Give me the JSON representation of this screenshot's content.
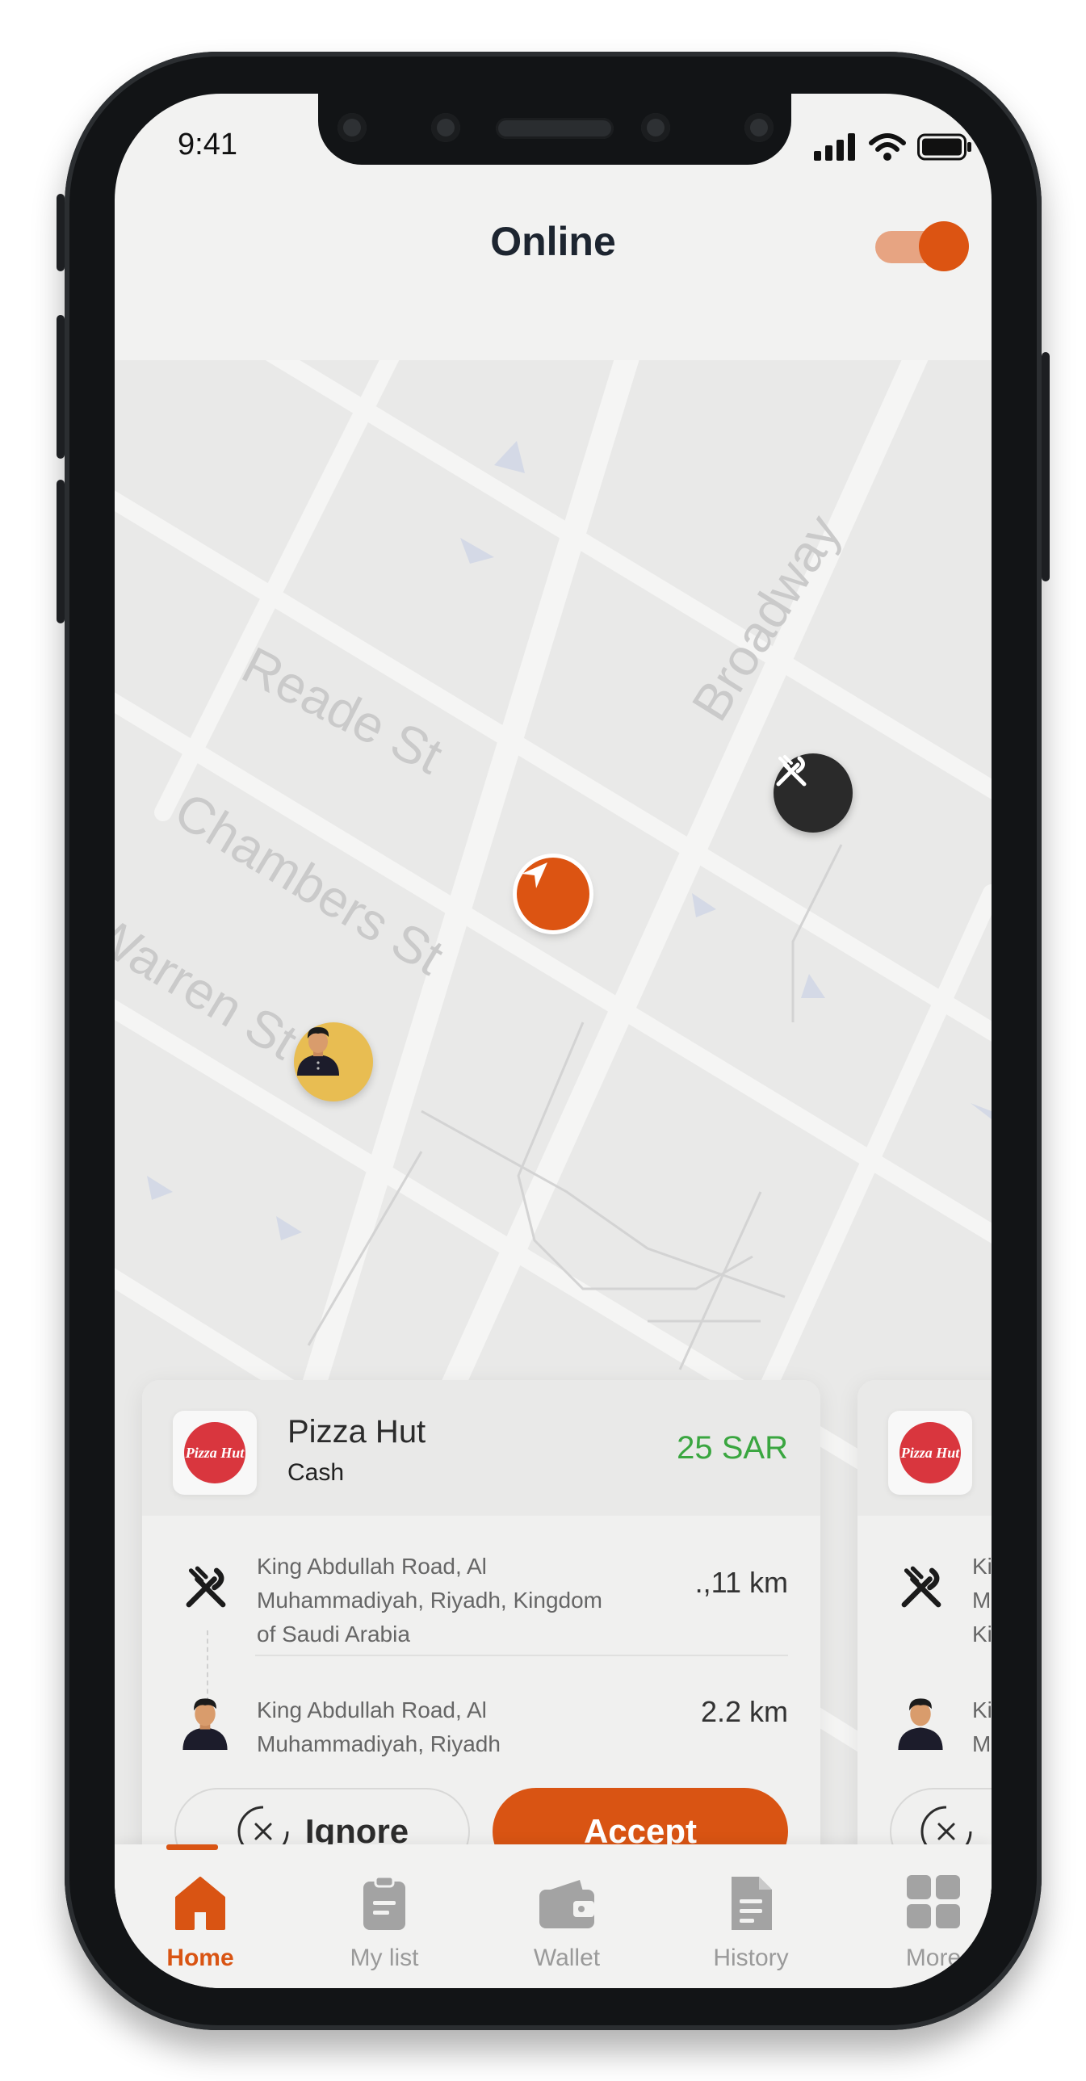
{
  "status_bar": {
    "time": "9:41"
  },
  "header": {
    "title": "Online",
    "online_toggle": "on"
  },
  "map": {
    "streets": [
      "Reade St",
      "Chambers St",
      "Warren St",
      "Broadway"
    ],
    "markers": [
      "restaurant-icon",
      "navigation-arrow-icon",
      "customer-avatar"
    ]
  },
  "order_card": {
    "restaurant": "Pizza Hut",
    "logo_text": "Pizza Hut",
    "payment": "Cash",
    "price": "25 SAR",
    "pickup": {
      "address": "King Abdullah Road, Al Muhammadiyah, Riyadh, Kingdom of Saudi Arabia",
      "distance": ".,11 km"
    },
    "dropoff": {
      "address": "King Abdullah Road, Al Muhammadiyah, Riyadh",
      "distance": "2.2 km"
    },
    "ignore_label": "Ignore",
    "accept_label": "Accept"
  },
  "next_card": {
    "pickup_fragment": "Ki\nM\nKi",
    "dropoff_fragment": "Ki\nM"
  },
  "nav": {
    "items": [
      {
        "label": "Home",
        "icon": "home-icon",
        "active": true
      },
      {
        "label": "My list",
        "icon": "clipboard-icon",
        "active": false
      },
      {
        "label": "Wallet",
        "icon": "wallet-icon",
        "active": false
      },
      {
        "label": "History",
        "icon": "document-icon",
        "active": false
      },
      {
        "label": "More",
        "icon": "grid-icon",
        "active": false
      }
    ]
  },
  "colors": {
    "accent": "#d95413",
    "price_green": "#3aa640",
    "text_dark": "#1d2530",
    "map_bg": "#e9e9e8"
  }
}
